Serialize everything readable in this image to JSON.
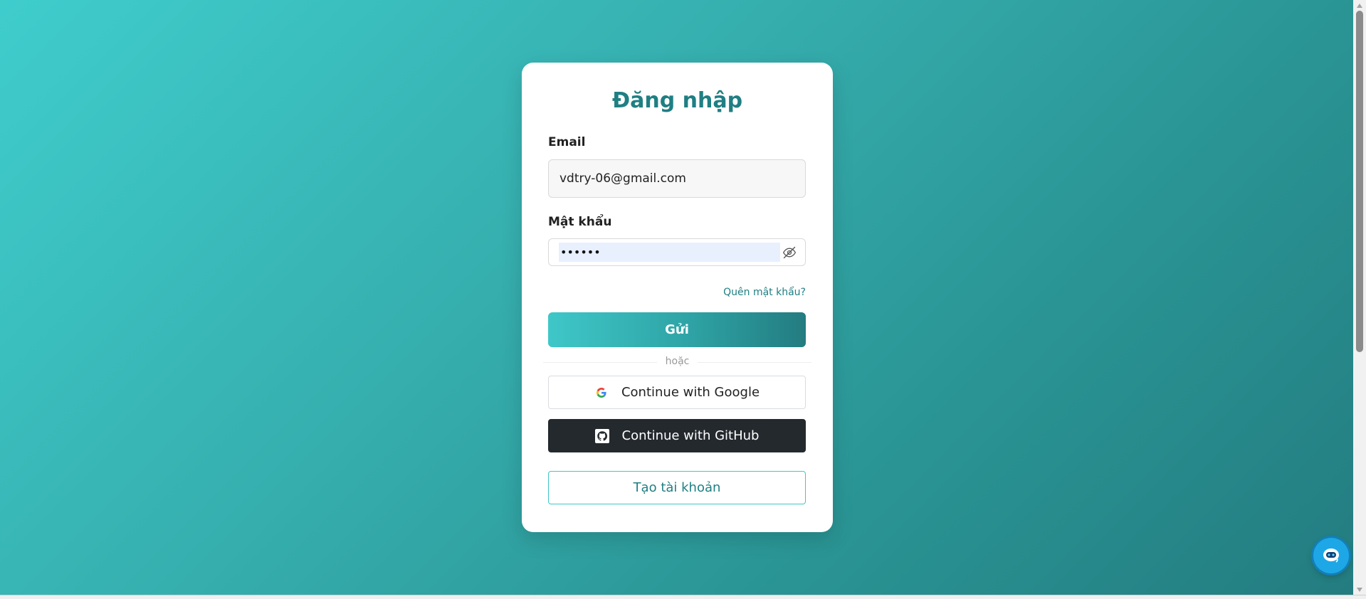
{
  "login": {
    "title": "Đăng nhập",
    "email_label": "Email",
    "email_value": "vdtry-06@gmail.com",
    "password_label": "Mật khẩu",
    "password_value": "••••••",
    "forgot_link": "Quên mật khẩu?",
    "submit_label": "Gửi",
    "divider_text": "hoặc",
    "google_label": "Continue with Google",
    "github_label": "Continue with GitHub",
    "create_account_label": "Tạo tài khoản"
  },
  "icons": {
    "password_toggle": "eye-slash-icon",
    "google": "google-icon",
    "github": "github-icon",
    "chat": "chatbot-icon"
  },
  "colors": {
    "accent": "#1f7f83",
    "gradient_start": "#3fcdcc",
    "gradient_end": "#237c80",
    "github_bg": "#24292e",
    "chat_button": "#1ea7e6"
  }
}
